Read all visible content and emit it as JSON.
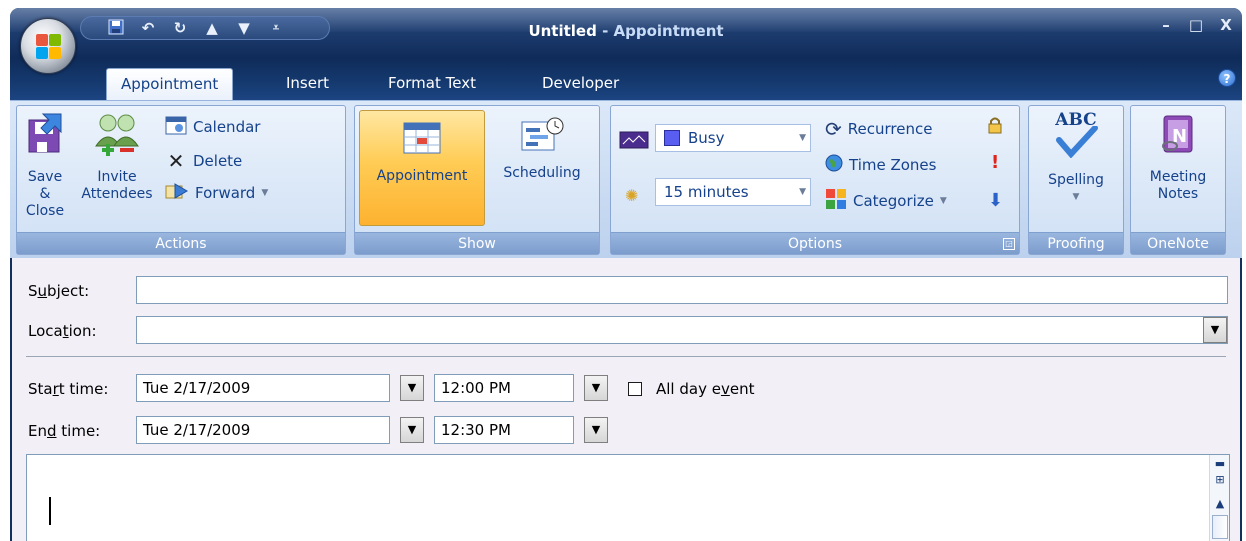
{
  "window": {
    "title_main": "Untitled",
    "title_sep": " - ",
    "title_sub": "Appointment",
    "minimize": "–",
    "maximize": "□",
    "close": "X"
  },
  "qat": {
    "save_icon": "save-icon",
    "undo_icon": "undo-icon",
    "redo_icon": "redo-icon",
    "up_icon": "up-arrow-icon",
    "down_icon": "down-arrow-icon",
    "customize_icon": "customize-icon"
  },
  "tabs": [
    {
      "label": "Appointment",
      "active": true
    },
    {
      "label": "Insert",
      "active": false
    },
    {
      "label": "Format Text",
      "active": false
    },
    {
      "label": "Developer",
      "active": false
    }
  ],
  "help": "?",
  "groups": {
    "actions": {
      "label": "Actions",
      "save_close_line1": "Save &",
      "save_close_line2": "Close",
      "invite_line1": "Invite",
      "invite_line2": "Attendees",
      "calendar": "Calendar",
      "delete": "Delete",
      "forward": "Forward"
    },
    "show": {
      "label": "Show",
      "appointment": "Appointment",
      "scheduling": "Scheduling"
    },
    "options": {
      "label": "Options",
      "show_as": "Busy",
      "reminder": "15 minutes",
      "recurrence": "Recurrence",
      "time_zones": "Time Zones",
      "categorize": "Categorize"
    },
    "proofing": {
      "label": "Proofing",
      "spelling": "Spelling",
      "abc": "ABC"
    },
    "onenote": {
      "label": "OneNote",
      "meeting_line1": "Meeting",
      "meeting_line2": "Notes"
    }
  },
  "form": {
    "subject_label_pre": "S",
    "subject_label_u": "u",
    "subject_label_post": "bject:",
    "subject_value": "",
    "location_label_pre": "Loca",
    "location_label_u": "t",
    "location_label_post": "ion:",
    "location_value": "",
    "start_label_pre": "Sta",
    "start_label_u": "r",
    "start_label_post": "t time:",
    "start_date": "Tue 2/17/2009",
    "start_time": "12:00 PM",
    "allday_pre": "All day e",
    "allday_u": "v",
    "allday_post": "ent",
    "end_label_pre": "En",
    "end_label_u": "d",
    "end_label_post": " time:",
    "end_date": "Tue 2/17/2009",
    "end_time": "12:30 PM"
  },
  "colors": {
    "titlebar": "#1e3d70",
    "ribbon": "#dbe8f8",
    "accent_active": "#ffcc55",
    "text_blue": "#15428b",
    "busy_blue": "#5a5ef0"
  }
}
